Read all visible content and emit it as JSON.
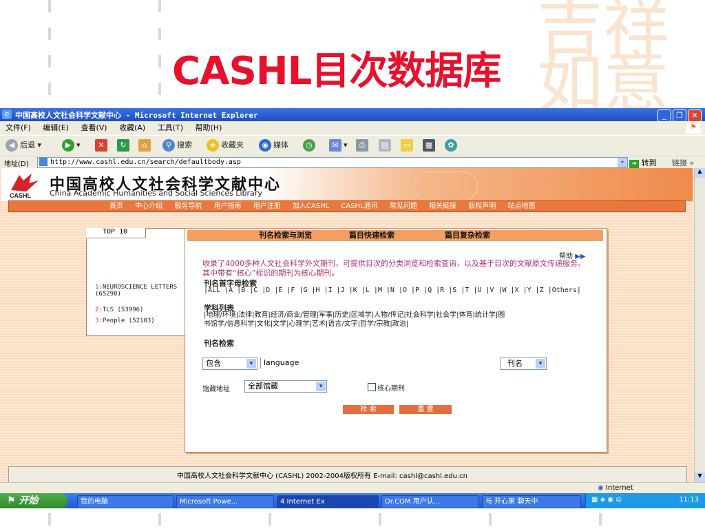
{
  "slide": {
    "title": "CASHL目次数据库"
  },
  "window": {
    "title": "中国高校人文社会科学文献中心 - Microsoft Internet Explorer",
    "menu": [
      "文件(F)",
      "编辑(E)",
      "查看(V)",
      "收藏(A)",
      "工具(T)",
      "帮助(H)"
    ],
    "toolbar": {
      "back": "后退",
      "search": "搜索",
      "favorites": "收藏夹",
      "media": "媒体"
    },
    "address_label": "地址(D)",
    "address": "http://www.cashl.edu.cn/search/defaultbody.asp",
    "go": "转到",
    "links": "链接"
  },
  "site": {
    "logo_text": "CASHL",
    "title_cn": "中国高校人文社会科学文献中心",
    "title_en": "China Academic Humanities and Social Sciences Library",
    "nav": [
      "首页",
      "中心介绍",
      "服务导航",
      "用户指南",
      "用户注册",
      "加入CASHL",
      "CASHL通讯",
      "常见问题",
      "相关链接",
      "版权声明",
      "站点地图"
    ]
  },
  "top10": {
    "label": "TOP 10",
    "items": [
      {
        "rank": "1:",
        "name": "NEUROSCIENCE LETTERS (65290)"
      },
      {
        "rank": "2:",
        "name": "TLS (53996)"
      },
      {
        "rank": "3:",
        "name": "People (52103)"
      }
    ]
  },
  "panel": {
    "tabs": [
      "刊名检索与浏览",
      "篇目快速检索",
      "篇目复杂检索"
    ],
    "help": "帮助",
    "intro": "收录了4000多种人文社会科学外文期刊，可提供目次的分类浏览和检索查询，以及基于目次的文献原文传递服务。其中带有“核心”标识的期刊为核心期刊。",
    "alpha_heading": "刊名首字母检索",
    "letters": "|ALL |A |B |C |D |E |F |G |H |I |J |K |L |M |N |O |P |Q |R |S |T |U |V |W |X |Y |Z |Others|",
    "subject_heading": "学科列表",
    "subjects_line1": "|地理/环境|法律|教育|经济/商业/管理|军事|历史|区域学|人物/传记|社会科学|社会学|体育|统计学|图",
    "subjects_line2": "书馆学/信息科学|文化|文学|心理学|艺术|语言/文字|哲学/宗教|政治|",
    "title_search_heading": "刊名检索",
    "match_select": "包含",
    "search_value": "language",
    "field_select": "刊名",
    "library_label": "馆藏地址",
    "library_select": "全部馆藏",
    "core_label": "核心期刊",
    "search_button": "检 索",
    "reset_button": "重 置"
  },
  "footer": {
    "text": "中国高校人文社会科学文献中心 (CASHL)  2002-2004版权所有 E-mail: cashl@cashl.edu.cn"
  },
  "status": {
    "zone": "Internet"
  },
  "taskbar": {
    "start": "开始",
    "items": [
      "我的电脑",
      "Microsoft Powe...",
      "4 Internet Ex",
      "Dr.COM 用户认...",
      "与 开心果 聊天中"
    ],
    "clock": "11:13"
  }
}
